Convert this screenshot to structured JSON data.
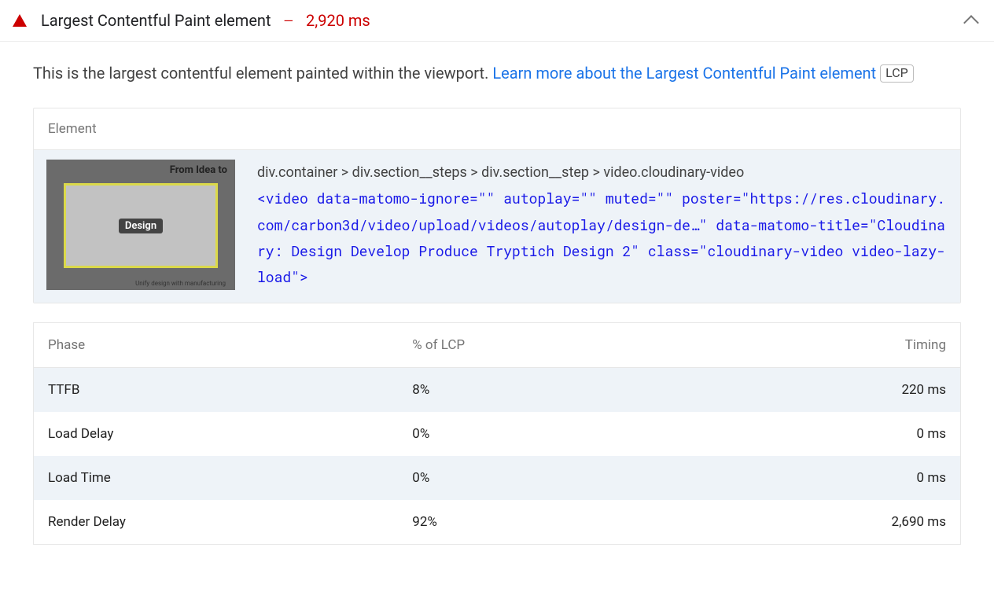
{
  "header": {
    "title": "Largest Contentful Paint element",
    "dash": "—",
    "metric": "2,920 ms"
  },
  "description": {
    "lead": "This is the largest contentful element painted within the viewport. ",
    "link_text": "Learn more about the Largest Contentful Paint element",
    "tag": "LCP"
  },
  "element": {
    "section_label": "Element",
    "thumb_top": "From Idea to",
    "thumb_chip": "Design",
    "thumb_bottom": "Unify design with manufacturing",
    "selector": "div.container > div.section__steps > div.section__step > video.cloudinary-video",
    "snippet": "<video data-matomo-ignore=\"\" autoplay=\"\" muted=\"\" poster=\"https://res.cloudinary.com/carbon3d/video/upload/videos/autoplay/design-de…\" data-matomo-title=\"Cloudinary: Design Develop Produce Tryptich Design 2\" class=\"cloudinary-video video-lazy-load\">"
  },
  "phase_table": {
    "columns": {
      "phase": "Phase",
      "pct": "% of LCP",
      "timing": "Timing"
    },
    "rows": [
      {
        "phase": "TTFB",
        "pct": "8%",
        "timing": "220 ms"
      },
      {
        "phase": "Load Delay",
        "pct": "0%",
        "timing": "0 ms"
      },
      {
        "phase": "Load Time",
        "pct": "0%",
        "timing": "0 ms"
      },
      {
        "phase": "Render Delay",
        "pct": "92%",
        "timing": "2,690 ms"
      }
    ]
  },
  "chart_data": {
    "type": "table",
    "title": "LCP Phase Breakdown",
    "columns": [
      "Phase",
      "% of LCP",
      "Timing (ms)"
    ],
    "rows": [
      [
        "TTFB",
        8,
        220
      ],
      [
        "Load Delay",
        0,
        0
      ],
      [
        "Load Time",
        0,
        0
      ],
      [
        "Render Delay",
        92,
        2690
      ]
    ],
    "total_lcp_ms": 2920
  }
}
